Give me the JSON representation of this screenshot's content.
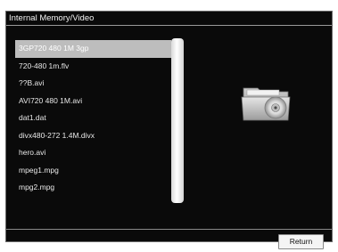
{
  "window": {
    "title": "Internal Memory/Video"
  },
  "file_list": {
    "selected_index": 0,
    "items": [
      {
        "label": "3GP720 480 1M 3gp"
      },
      {
        "label": "720-480 1m.flv"
      },
      {
        "label": "??B.avi"
      },
      {
        "label": "AVI720 480 1M.avi"
      },
      {
        "label": "dat1.dat"
      },
      {
        "label": "divx480-272 1.4M.divx"
      },
      {
        "label": "hero.avi"
      },
      {
        "label": "mpeg1.mpg"
      },
      {
        "label": "mpg2.mpg"
      }
    ]
  },
  "preview": {
    "icon": "folder-disc-icon"
  },
  "footer": {
    "return_label": "Return"
  },
  "colors": {
    "background": "#0a0a0a",
    "selection": "#bdbdbd",
    "text": "#e8e8e8"
  }
}
